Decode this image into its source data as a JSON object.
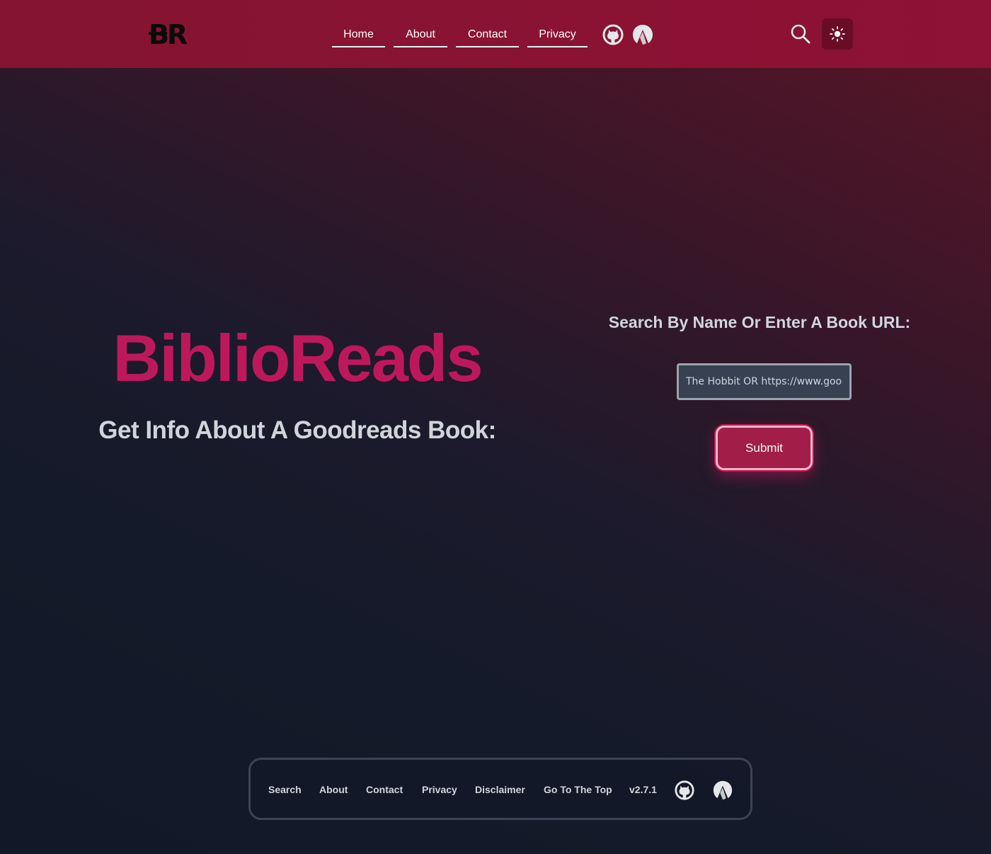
{
  "header": {
    "logo_text": "BR",
    "nav": [
      {
        "label": "Home"
      },
      {
        "label": "About"
      },
      {
        "label": "Contact"
      },
      {
        "label": "Privacy"
      }
    ],
    "icons": [
      "github-icon",
      "codeberg-icon",
      "search-icon",
      "sun-icon"
    ]
  },
  "hero": {
    "brand": "BiblioReads",
    "tagline": "Get Info About A Goodreads Book:"
  },
  "search": {
    "heading": "Search By Name Or Enter A Book URL:",
    "placeholder": "The Hobbit OR https://www.goodreads.com/...",
    "submit_label": "Submit"
  },
  "footer": {
    "links": [
      "Search",
      "About",
      "Contact",
      "Privacy",
      "Disclaimer",
      "Go To The Top"
    ],
    "version": "v2.7.1"
  },
  "colors": {
    "header_bg": "#8a1333",
    "brand": "#be185d",
    "button_bg": "#a31d49",
    "page_bg_dark": "#121827"
  }
}
